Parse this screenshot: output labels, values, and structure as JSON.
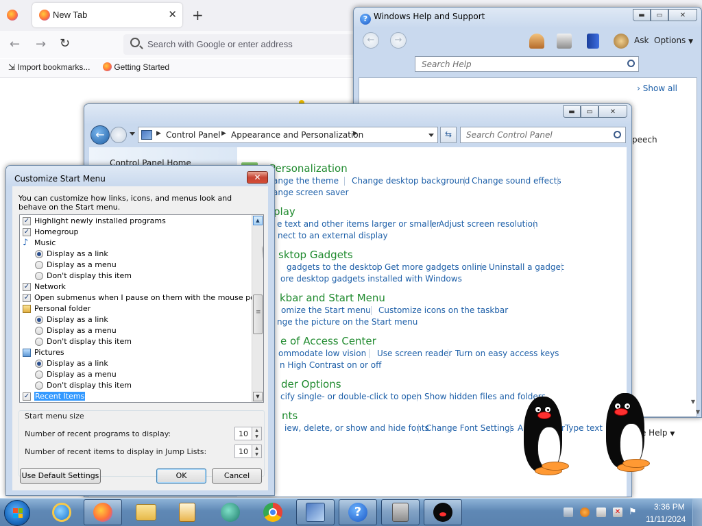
{
  "firefox": {
    "tab_title": "New Tab",
    "url_placeholder": "Search with Google or enter address",
    "bookmarks": [
      "Import bookmarks...",
      "Getting Started"
    ]
  },
  "help_window": {
    "title": "Windows Help and Support",
    "toolbar": {
      "ask": "Ask",
      "options": "Options"
    },
    "search_placeholder": "Search Help",
    "show_all": "Show all",
    "partial_link": "peech",
    "partial_online_help": "ine Help"
  },
  "control_panel": {
    "breadcrumb": [
      "Control Panel",
      "Appearance and Personalization"
    ],
    "search_placeholder": "Search Control Panel",
    "sidebar": {
      "home": "Control Panel Home"
    },
    "categories": [
      {
        "title": "Personalization",
        "links": [
          [
            "ange the theme",
            "Change desktop background",
            "Change sound effects"
          ],
          [
            "ange screen saver"
          ]
        ]
      },
      {
        "title": "play",
        "links": [
          [
            "e text and other items larger or smaller",
            "Adjust screen resolution"
          ],
          [
            "nect to an external display"
          ]
        ]
      },
      {
        "title": "sktop Gadgets",
        "links": [
          [
            "gadgets to the desktop",
            "Get more gadgets online",
            "Uninstall a gadget"
          ],
          [
            "ore desktop gadgets installed with Windows"
          ]
        ]
      },
      {
        "title": "kbar and Start Menu",
        "links": [
          [
            "omize the Start menu",
            "Customize icons on the taskbar"
          ],
          [
            "nge the picture on the Start menu"
          ]
        ]
      },
      {
        "title": "e of Access Center",
        "links": [
          [
            "ommodate low vision",
            "Use screen reader",
            "Turn on easy access keys"
          ],
          [
            "n High Contrast on or off"
          ]
        ]
      },
      {
        "title": "der Options",
        "links": [
          [
            "cify single- or double-click to open",
            "Show hidden files and folders"
          ]
        ]
      },
      {
        "title": "nts",
        "links": [
          [
            "iew, delete, or show and hide fonts",
            "Change Font Settings",
            "A",
            "rType text"
          ]
        ]
      }
    ]
  },
  "dialog": {
    "title": "Customize Start Menu",
    "close_label": "✕",
    "description": "You can customize how links, icons, and menus look and behave on the Start menu.",
    "items": [
      {
        "kind": "checkbox",
        "label": "Highlight newly installed programs",
        "checked": true
      },
      {
        "kind": "checkbox",
        "label": "Homegroup",
        "checked": true
      },
      {
        "kind": "group",
        "label": "Music",
        "icon": "music-note-icon"
      },
      {
        "kind": "radio",
        "label": "Display as a link",
        "checked": true
      },
      {
        "kind": "radio",
        "label": "Display as a menu",
        "checked": false
      },
      {
        "kind": "radio",
        "label": "Don't display this item",
        "checked": false
      },
      {
        "kind": "checkbox",
        "label": "Network",
        "checked": true
      },
      {
        "kind": "checkbox",
        "label": "Open submenus when I pause on them with the mouse pointer",
        "checked": true
      },
      {
        "kind": "group",
        "label": "Personal folder",
        "icon": "folder-icon"
      },
      {
        "kind": "radio",
        "label": "Display as a link",
        "checked": true
      },
      {
        "kind": "radio",
        "label": "Display as a menu",
        "checked": false
      },
      {
        "kind": "radio",
        "label": "Don't display this item",
        "checked": false
      },
      {
        "kind": "group",
        "label": "Pictures",
        "icon": "pictures-icon"
      },
      {
        "kind": "radio",
        "label": "Display as a link",
        "checked": true
      },
      {
        "kind": "radio",
        "label": "Display as a menu",
        "checked": false
      },
      {
        "kind": "radio",
        "label": "Don't display this item",
        "checked": false
      },
      {
        "kind": "checkbox",
        "label": "Recent Items",
        "checked": true,
        "selected": true
      }
    ],
    "size_group_label": "Start menu size",
    "recent_programs_label": "Number of recent programs to display:",
    "recent_programs_value": "10",
    "recent_items_label": "Number of recent items to display in Jump Lists:",
    "recent_items_value": "10",
    "buttons": {
      "default_settings": "Use Default Settings",
      "ok": "OK",
      "cancel": "Cancel"
    }
  },
  "taskbar": {
    "apps": [
      "internet-explorer",
      "firefox",
      "file-explorer",
      "media-player",
      "sparkle-app",
      "chrome",
      "control-panel",
      "help-and-support",
      "server-manager",
      "penguin-app"
    ],
    "time": "3:36 PM",
    "date": "11/11/2024"
  },
  "colors": {
    "link_blue": "#1d5fa8",
    "category_green": "#1f8a2e",
    "selection_blue": "#3399ff"
  }
}
